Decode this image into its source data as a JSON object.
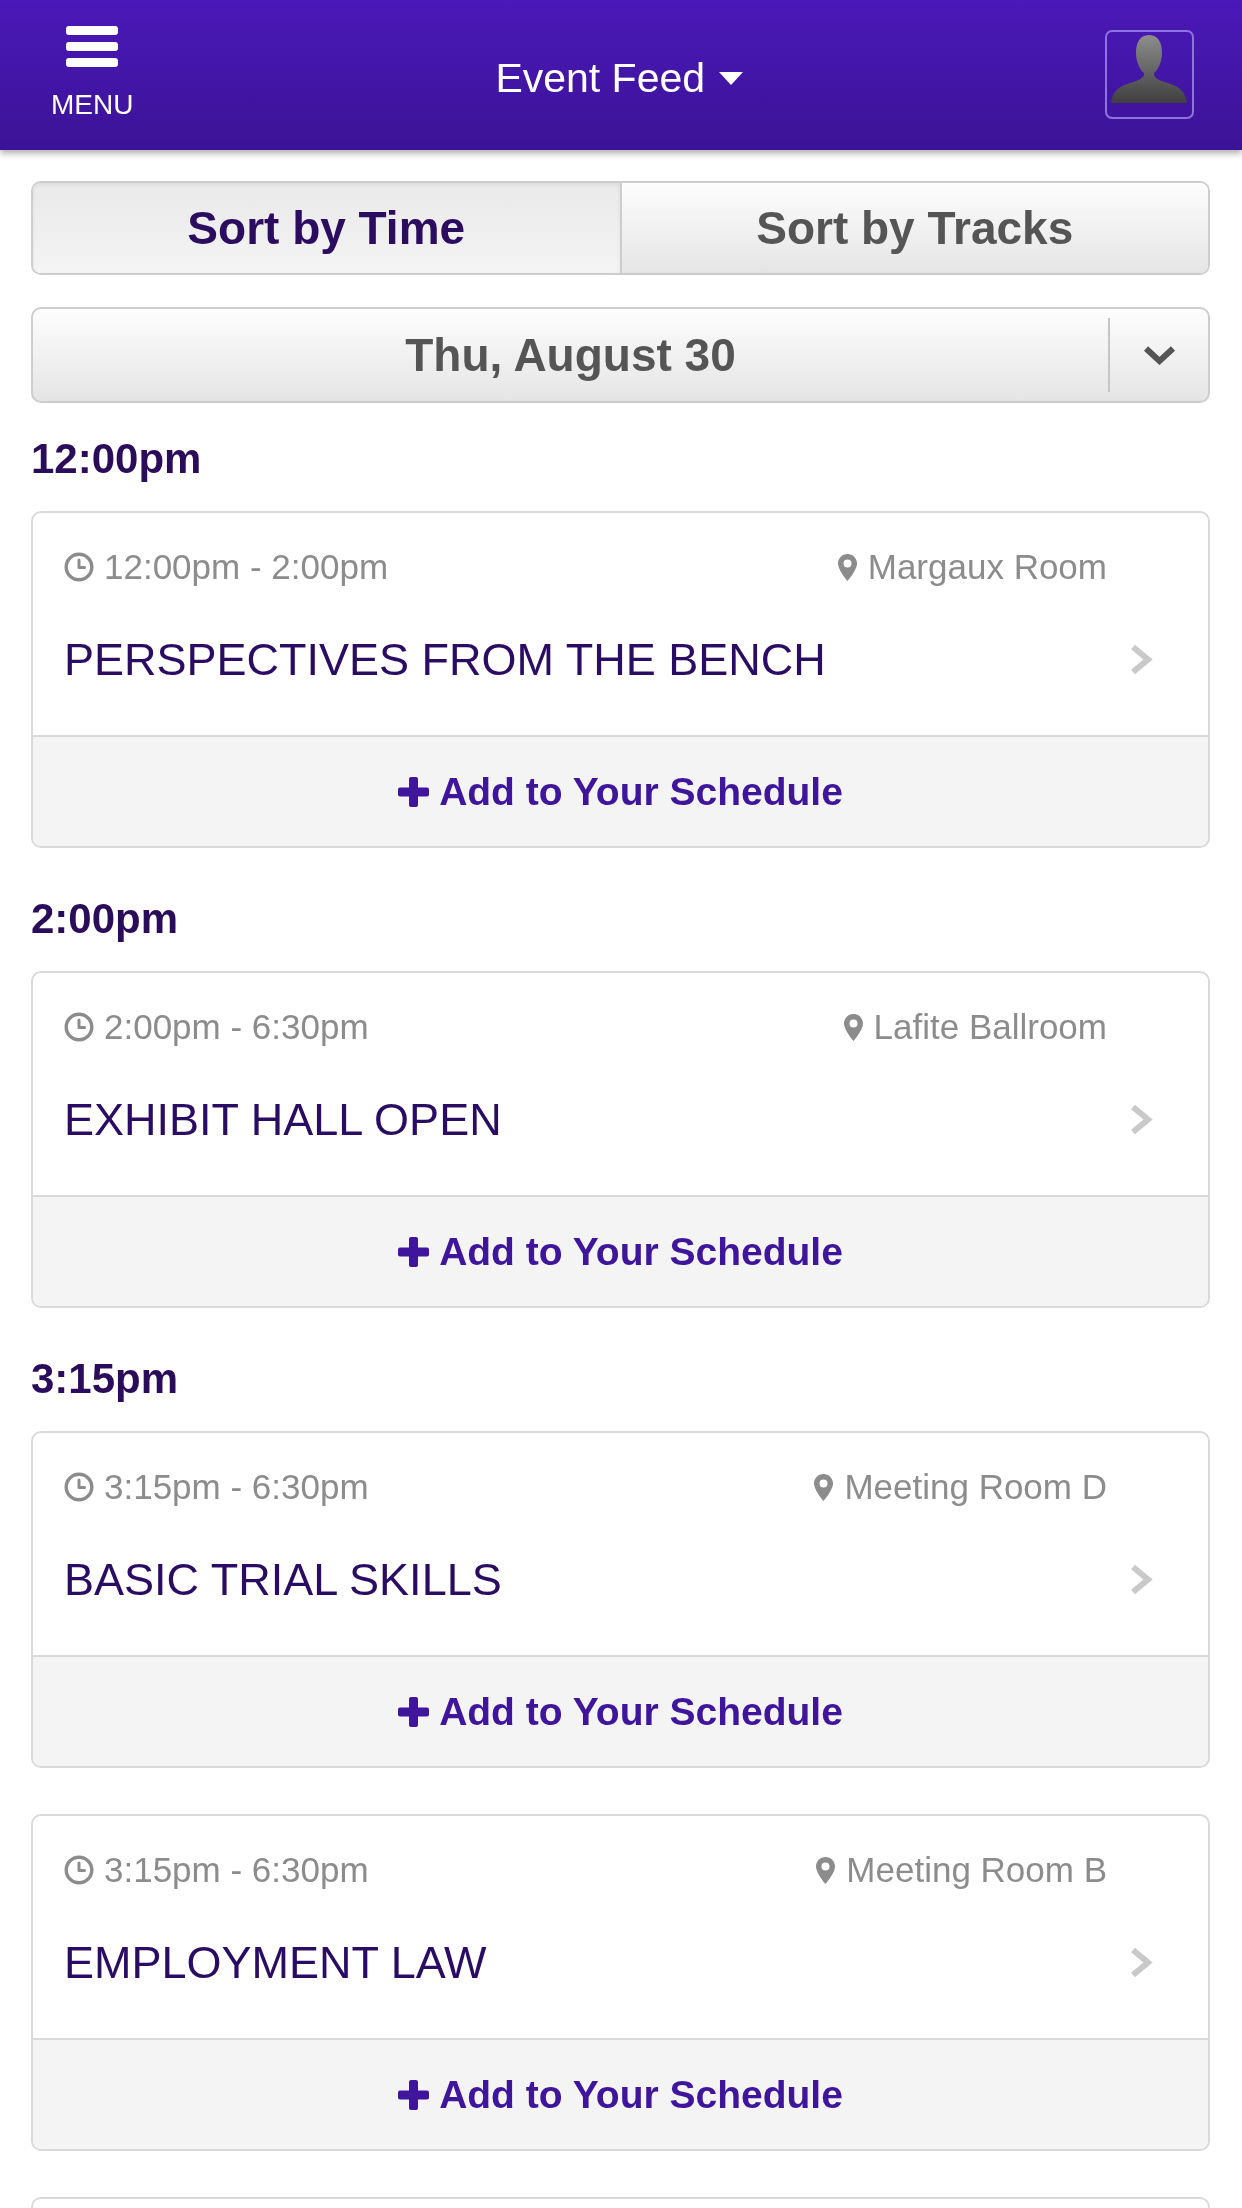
{
  "header": {
    "menu_label": "MENU",
    "title": "Event Feed"
  },
  "sort_tabs": [
    {
      "label": "Sort by Time",
      "selected": true
    },
    {
      "label": "Sort by Tracks",
      "selected": false
    }
  ],
  "date_select": {
    "value": "Thu, August 30"
  },
  "groups": [
    {
      "time": "12:00pm",
      "events": [
        {
          "time_range": "12:00pm - 2:00pm",
          "location": "Margaux Room",
          "title": "PERSPECTIVES FROM THE BENCH",
          "action": "Add to Your Schedule"
        }
      ]
    },
    {
      "time": "2:00pm",
      "events": [
        {
          "time_range": "2:00pm - 6:30pm",
          "location": "Lafite Ballroom",
          "title": "EXHIBIT HALL OPEN",
          "action": "Add to Your Schedule"
        }
      ]
    },
    {
      "time": "3:15pm",
      "events": [
        {
          "time_range": "3:15pm - 6:30pm",
          "location": "Meeting Room D",
          "title": "BASIC TRIAL SKILLS",
          "action": "Add to Your Schedule"
        },
        {
          "time_range": "3:15pm - 6:30pm",
          "location": "Meeting Room B",
          "title": "EMPLOYMENT LAW",
          "action": "Add to Your Schedule"
        }
      ]
    }
  ],
  "next_card_partly_visible": true
}
